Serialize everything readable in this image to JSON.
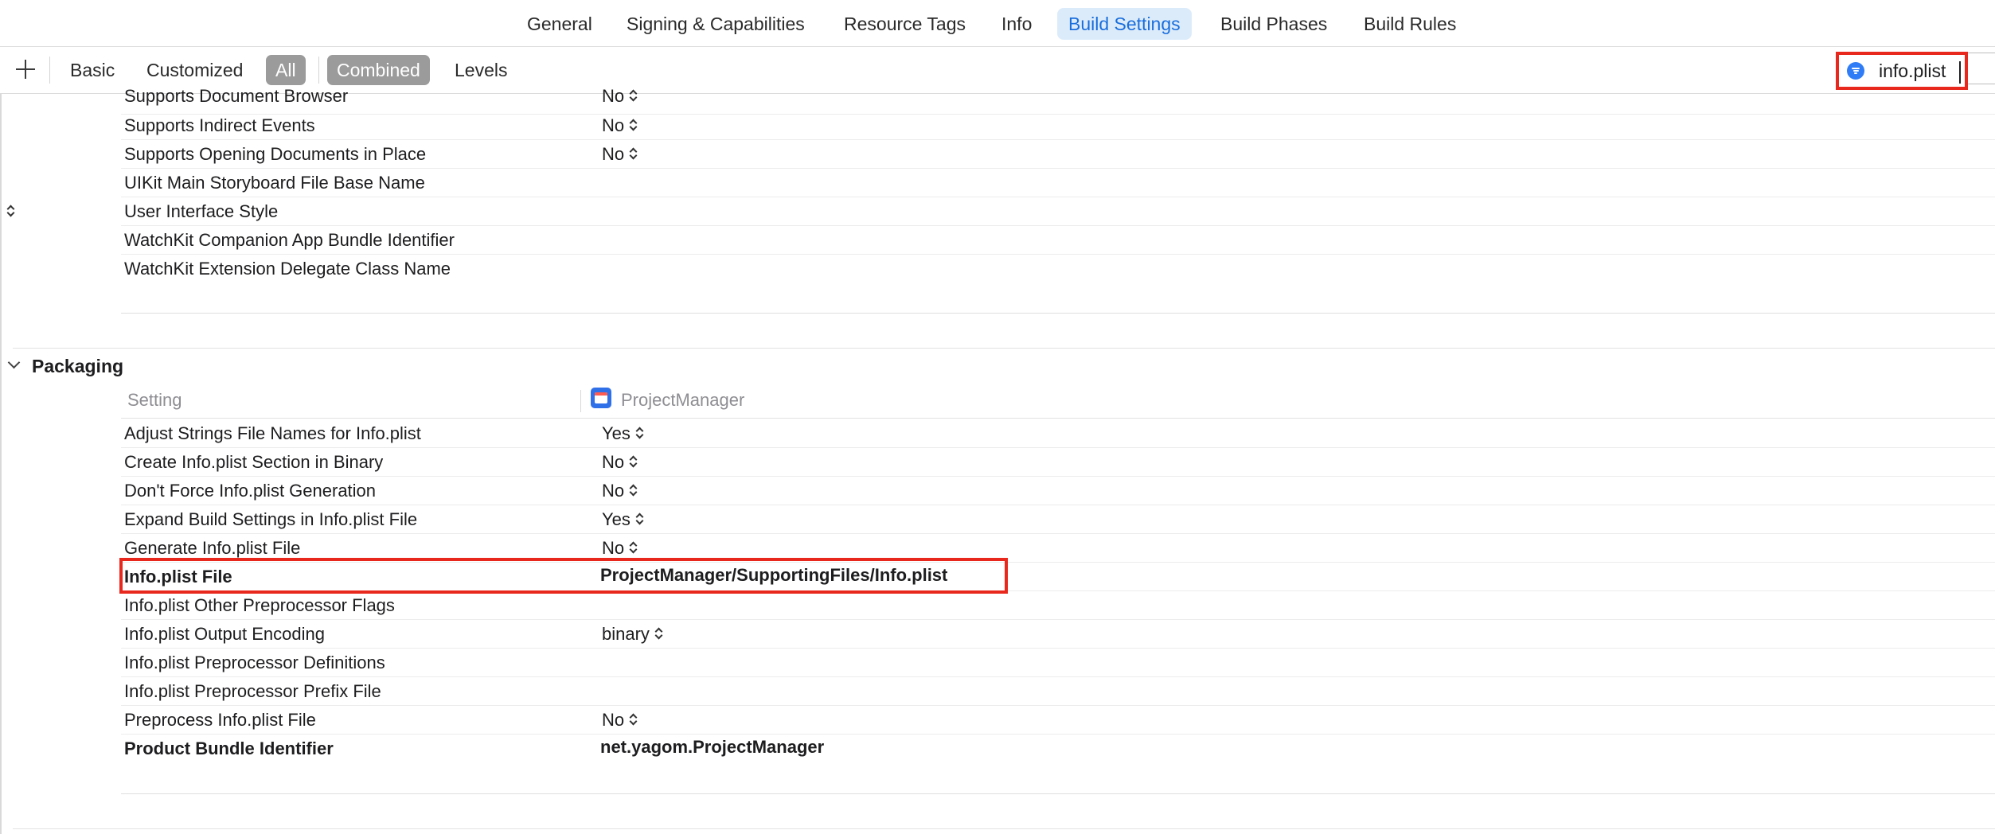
{
  "tabs": [
    {
      "label": "General"
    },
    {
      "label": "Signing & Capabilities"
    },
    {
      "label": "Resource Tags"
    },
    {
      "label": "Info"
    },
    {
      "label": "Build Settings",
      "active": true
    },
    {
      "label": "Build Phases"
    },
    {
      "label": "Build Rules"
    }
  ],
  "filters": {
    "add_icon": "plus-icon",
    "basic": "Basic",
    "customized": "Customized",
    "all": "All",
    "combined": "Combined",
    "levels": "Levels"
  },
  "search": {
    "value": "info.plist",
    "icon": "filter-icon"
  },
  "upper_rows": [
    {
      "name": "Supports Document Browser",
      "value": "No"
    },
    {
      "name": "Supports Indirect Events",
      "value": "No"
    },
    {
      "name": "Supports Opening Documents in Place",
      "value": "No"
    },
    {
      "name": "UIKit Main Storyboard File Base Name",
      "value": ""
    },
    {
      "name": "User Interface Style",
      "value": ""
    },
    {
      "name": "WatchKit Companion App Bundle Identifier",
      "value": ""
    },
    {
      "name": "WatchKit Extension Delegate Class Name",
      "value": ""
    }
  ],
  "packaging": {
    "title": "Packaging",
    "col_setting": "Setting",
    "col_target": "ProjectManager",
    "rows": [
      {
        "name": "Adjust Strings File Names for Info.plist",
        "value": "Yes"
      },
      {
        "name": "Create Info.plist Section in Binary",
        "value": "No"
      },
      {
        "name": "Don't Force Info.plist Generation",
        "value": "No"
      },
      {
        "name": "Expand Build Settings in Info.plist File",
        "value": "Yes"
      },
      {
        "name": "Generate Info.plist File",
        "value": "No"
      },
      {
        "name": "Info.plist File",
        "value": "ProjectManager/SupportingFiles/Info.plist"
      },
      {
        "name": "Info.plist Other Preprocessor Flags",
        "value": ""
      },
      {
        "name": "Info.plist Output Encoding",
        "value": "binary"
      },
      {
        "name": "Info.plist Preprocessor Definitions",
        "value": ""
      },
      {
        "name": "Info.plist Preprocessor Prefix File",
        "value": ""
      },
      {
        "name": "Preprocess Info.plist File",
        "value": "No"
      },
      {
        "name": "Product Bundle Identifier",
        "value": "net.yagom.ProjectManager"
      }
    ]
  },
  "colors": {
    "accent": "#1a6fdd",
    "tab_active_bg": "#dcebfa",
    "highlight": "#e8281c",
    "segment_on": "#9b9b9b"
  }
}
